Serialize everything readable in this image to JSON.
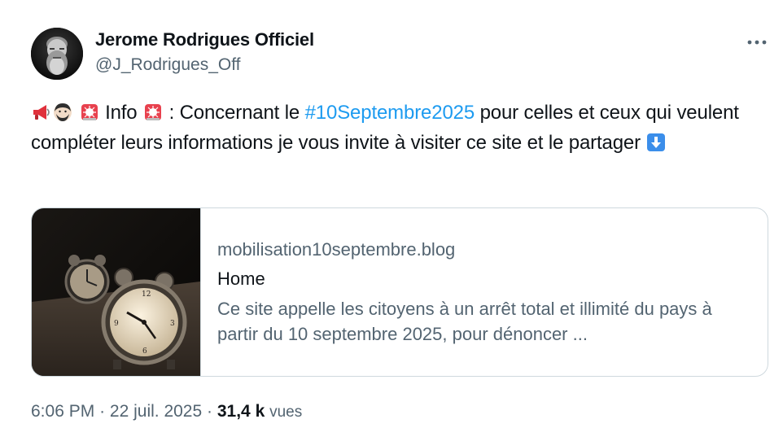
{
  "author": {
    "display_name": "Jerome Rodrigues Officiel",
    "handle": "@J_Rodrigues_Off",
    "avatar_icon": "bearded-man-portrait"
  },
  "more_icon": "more-horizontal-icon",
  "tweet": {
    "emojis": [
      "megaphone-icon",
      "man-emoji-icon",
      "rotating-light-icon",
      "rotating-light-icon",
      "down-arrow-emoji-icon"
    ],
    "text_info": "Info",
    "text_colon_prefix": ": Concernant le",
    "hashtag": "#10Septembre2025",
    "text_after_hashtag": "pour celles et ceux qui veulent compléter leurs informations je vous invite à visiter ce site et le partager"
  },
  "link_card": {
    "domain": "mobilisation10septembre.blog",
    "title": "Home",
    "description": "Ce site appelle les citoyens à un arrêt total et illimité du pays à partir du 10 septembre 2025, pour dénoncer ...",
    "image_icon": "alarm-clock-image"
  },
  "meta": {
    "time": "6:06 PM",
    "date": "22 juil. 2025",
    "views_count": "31,4 k",
    "views_label": "vues"
  },
  "colors": {
    "hashtag": "#1d9bf0",
    "secondary_text": "#536471",
    "primary_text": "#0f1419",
    "border": "#cfd9de"
  }
}
